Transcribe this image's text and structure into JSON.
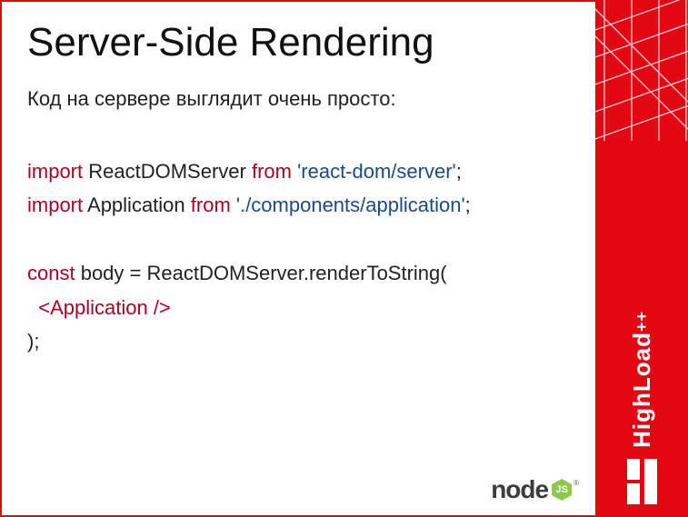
{
  "title": "Server-Side Rendering",
  "subtitle": "Код на сервере выглядит очень просто:",
  "code": {
    "line1": {
      "kw1": "import",
      "name1": " ReactDOMServer ",
      "kw2": "from",
      "str1": " 'react-dom/server'",
      "semi": ";"
    },
    "line2": {
      "kw1": "import",
      "name1": " Application ",
      "kw2": "from",
      "str1": " './components/application'",
      "semi": ";"
    },
    "line3": {
      "kw1": "const",
      "rest": " body = ReactDOMServer.renderToString("
    },
    "line4": {
      "indent": "  ",
      "jsx": "<Application />"
    },
    "line5": ");"
  },
  "node": {
    "text": "node",
    "hex": "JS",
    "tm": "®"
  },
  "sidebar": {
    "brand": "HighLoad",
    "plus": "++"
  }
}
